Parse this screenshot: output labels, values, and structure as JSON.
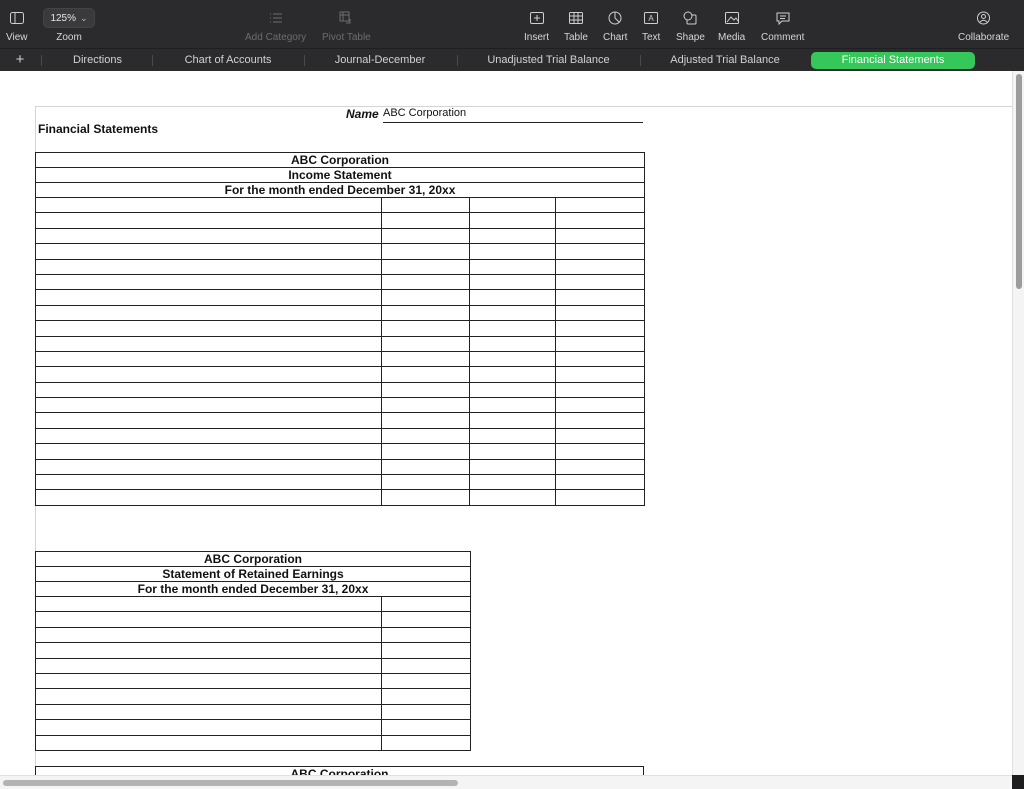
{
  "toolbar": {
    "view_label": "View",
    "zoom_value": "125%",
    "zoom_label": "Zoom",
    "add_category_label": "Add Category",
    "pivot_table_label": "Pivot Table",
    "insert_label": "Insert",
    "table_label": "Table",
    "chart_label": "Chart",
    "text_label": "Text",
    "shape_label": "Shape",
    "media_label": "Media",
    "comment_label": "Comment",
    "collaborate_label": "Collaborate"
  },
  "tabs": [
    {
      "label": "Directions"
    },
    {
      "label": "Chart of Accounts"
    },
    {
      "label": "Journal-December"
    },
    {
      "label": "Unadjusted Trial Balance"
    },
    {
      "label": "Adjusted Trial Balance"
    },
    {
      "label": "Financial Statements"
    }
  ],
  "active_tab": "Financial Statements",
  "sheet": {
    "name_label": "Name",
    "name_value": "ABC Corporation",
    "section_title": "Financial Statements",
    "income_statement": {
      "company": "ABC Corporation",
      "title": "Income Statement",
      "period": "For the month ended December 31, 20xx",
      "blank_rows": 20,
      "columns": 4
    },
    "retained_earnings": {
      "company": "ABC Corporation",
      "title": "Statement of Retained Earnings",
      "period": "For the month ended December 31, 20xx",
      "blank_rows": 10,
      "columns": 2
    },
    "third_statement": {
      "company": "ABC Corporation"
    }
  },
  "colors": {
    "toolbar_bg": "#2b2b2e",
    "active_tab": "#35c759",
    "grid_line": "#222222"
  }
}
